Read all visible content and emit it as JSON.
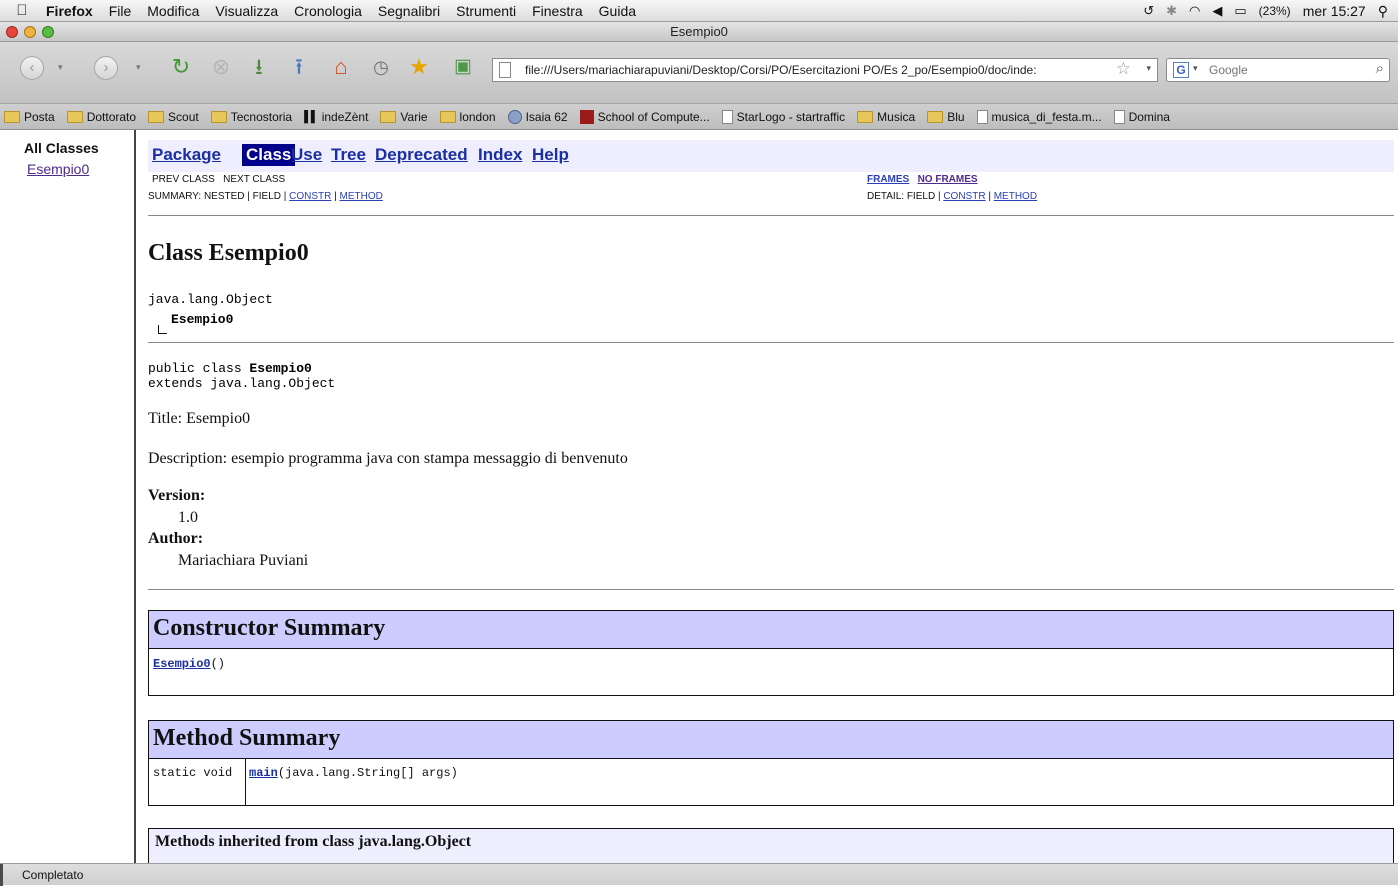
{
  "menubar": {
    "app": "Firefox",
    "items": [
      "File",
      "Modifica",
      "Visualizza",
      "Cronologia",
      "Segnalibri",
      "Strumenti",
      "Finestra",
      "Guida"
    ],
    "battery": "(23%)",
    "clock": "mer 15:27"
  },
  "window": {
    "title": "Esempio0"
  },
  "toolbar": {
    "url": "file:///Users/mariachiarapuviani/Desktop/Corsi/PO/Esercitazioni PO/Es 2_po/Esempio0/doc/inde:",
    "search_placeholder": "Google"
  },
  "bookmarks": [
    {
      "label": "Posta",
      "icon": "folder-icon"
    },
    {
      "label": "Dottorato",
      "icon": "folder-icon"
    },
    {
      "label": "Scout",
      "icon": "folder-icon"
    },
    {
      "label": "Tecnostoria",
      "icon": "folder-icon"
    },
    {
      "label": "indeZènt",
      "icon": "bars-icon"
    },
    {
      "label": "Varie",
      "icon": "folder-icon"
    },
    {
      "label": "london",
      "icon": "folder-icon"
    },
    {
      "label": "Isaia 62",
      "icon": "globe-icon"
    },
    {
      "label": "School of Compute...",
      "icon": "university-icon"
    },
    {
      "label": "StarLogo - startraffic",
      "icon": "page-icon"
    },
    {
      "label": "Musica",
      "icon": "folder-icon"
    },
    {
      "label": "Blu",
      "icon": "folder-icon"
    },
    {
      "label": "musica_di_festa.m...",
      "icon": "page-icon"
    },
    {
      "label": "Domina",
      "icon": "page-icon"
    }
  ],
  "left_frame": {
    "title": "All Classes",
    "classes": [
      "Esempio0"
    ]
  },
  "javadoc": {
    "nav": {
      "package": "Package",
      "class": "Class",
      "use": "Use",
      "tree": "Tree",
      "deprecated": "Deprecated",
      "index": "Index",
      "help": "Help"
    },
    "prev_next": "PREV CLASS   NEXT CLASS",
    "summary_prefix": "SUMMARY: NESTED | FIELD | ",
    "summary_constr": "CONSTR",
    "summary_sep": " | ",
    "summary_method": "METHOD",
    "frames": "FRAMES",
    "no_frames": "NO FRAMES",
    "detail_prefix": "DETAIL: FIELD | ",
    "detail_constr": "CONSTR",
    "detail_sep": " | ",
    "detail_method": "METHOD",
    "class_title": "Class Esempio0",
    "tree_parent": "java.lang.Object",
    "tree_child": "Esempio0",
    "decl_line1_prefix": "public class ",
    "decl_line1_name": "Esempio0",
    "decl_line2": "extends java.lang.Object",
    "title_line": "Title: Esempio0",
    "description_line": "Description: esempio programma java con stampa messaggio di benvenuto",
    "version_label": "Version:",
    "version_value": "1.0",
    "author_label": "Author:",
    "author_value": "Mariachiara Puviani",
    "constructor_summary": "Constructor Summary",
    "constructor_name": "Esempio0",
    "constructor_args": "()",
    "method_summary": "Method Summary",
    "method_modifier": "static void",
    "method_name": "main",
    "method_args": "(java.lang.String[] args)",
    "inherited_title": "Methods inherited from class java.lang.Object"
  },
  "status": {
    "text": "Completato"
  },
  "colors": {
    "nav_bar_bg": "#eeeeff",
    "nav_current_bg": "#00008b",
    "table_header_bg": "#ccccff",
    "link": "#1a2fa1",
    "visited_link": "#4e2a8a"
  }
}
